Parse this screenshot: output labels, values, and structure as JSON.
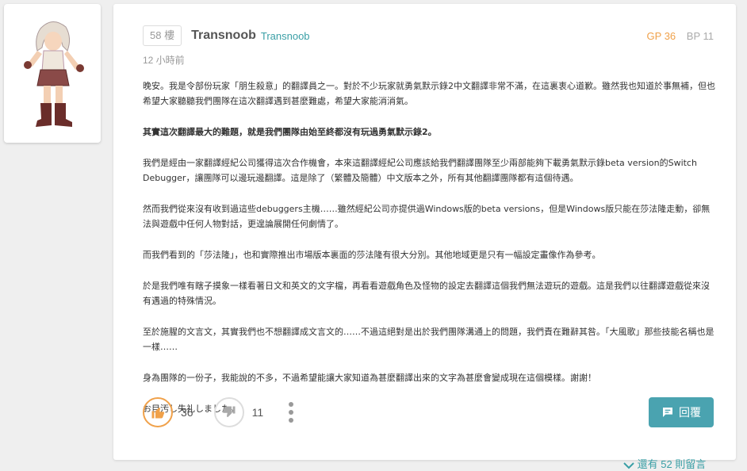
{
  "avatar": {
    "alt": "character avatar"
  },
  "post": {
    "floor": "58 樓",
    "author_name": "Transnoob",
    "author_id": "Transnoob",
    "gp": "GP 36",
    "bp": "BP 11",
    "time": "12 小時前",
    "paragraphs": [
      "晚安。我是令部份玩家「朋生殺意」的翻譯員之一。對於不少玩家就勇氣默示錄2中文翻譯非常不滿，在這裏衷心道歉。雖然我也知道於事無補，但也希望大家聽聽我們團隊在這次翻譯遇到甚麼難處，希望大家能消消氣。",
      "其實這次翻譯最大的難題，就是我們團隊由始至終都沒有玩過勇氣默示錄2。",
      "我們是經由一家翻譯經紀公司獲得這次合作機會，本來這翻譯經紀公司應該給我們翻譯團隊至少兩部能夠下載勇氣默示錄beta version的Switch Debugger，讓團隊可以邊玩邊翻譯。這是除了（繁體及簡體）中文版本之外，所有其他翻譯團隊都有這個待遇。",
      "然而我們從來沒有收到過這些debuggers主機……雖然經紀公司亦提供過Windows版的beta versions，但是Windows版只能在莎法隆走動，卻無法與遊戲中任何人物對話，更遑論展開任何劇情了。",
      "而我們看到的「莎法隆」，也和實際推出市場版本裏面的莎法隆有很大分別。其他地域更是只有一幅設定畫像作為參考。",
      "於是我們唯有瞎子摸象一樣看著日文和英文的文字檔，再看看遊戲角色及怪物的設定去翻譯這個我們無法遊玩的遊戲。這是我們以往翻譯遊戲從來沒有遇過的特殊情況。",
      "至於施腥的文言文，其實我們也不想翻譯成文言文的……不過這絕對是出於我們團隊溝通上的問題，我們責在難辭其咎。「大風歌」那些技能名稱也是一樣……",
      "身為團隊的一份子，我能說的不多，不過希望能讓大家知道為甚麼翻譯出來的文字為甚麼會變成現在這個模樣。謝謝！",
      "お目汚し失礼しました。"
    ],
    "like_count": "36",
    "dislike_count": "11",
    "reply_label": "回覆"
  },
  "footer": {
    "more_comments": "還有 52 則留言"
  },
  "colors": {
    "accent": "#3a9fa6",
    "gp": "#f0a14a",
    "reply_bg": "#4aa3b0"
  },
  "icons": {
    "like": "thumbs-up-icon",
    "dislike": "thumbs-down-icon",
    "more": "more-vertical-icon",
    "reply": "comment-icon",
    "expand": "chevron-down-icon"
  }
}
